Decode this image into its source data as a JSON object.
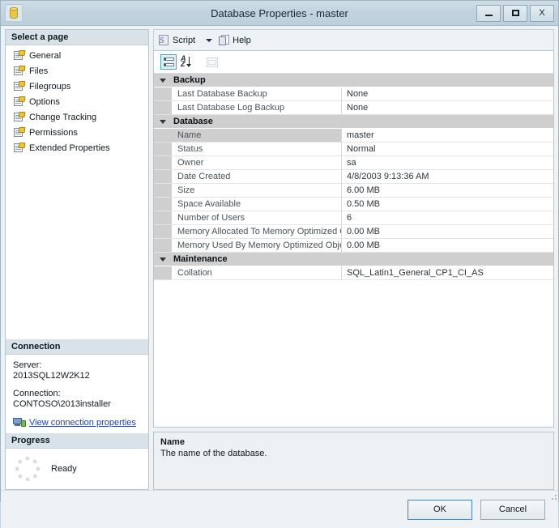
{
  "window": {
    "title": "Database Properties - master",
    "icon": "database-icon",
    "buttons": {
      "minimize": "—",
      "maximize": "□",
      "close": "X"
    }
  },
  "sidebar": {
    "header": "Select a page",
    "items": [
      {
        "label": "General",
        "icon": "page-icon"
      },
      {
        "label": "Files",
        "icon": "page-icon"
      },
      {
        "label": "Filegroups",
        "icon": "page-icon"
      },
      {
        "label": "Options",
        "icon": "page-icon"
      },
      {
        "label": "Change Tracking",
        "icon": "page-icon"
      },
      {
        "label": "Permissions",
        "icon": "page-icon"
      },
      {
        "label": "Extended Properties",
        "icon": "page-icon"
      }
    ]
  },
  "connection": {
    "header": "Connection",
    "server_label": "Server:",
    "server_value": "2013SQL12W2K12",
    "connection_label": "Connection:",
    "connection_value": "CONTOSO\\2013installer",
    "link": "View connection properties",
    "link_icon": "server-connection-icon"
  },
  "progress": {
    "header": "Progress",
    "status": "Ready",
    "icon": "spinner-icon"
  },
  "toolbar": {
    "script_label": "Script",
    "script_icon": "script-icon",
    "dropdown_icon": "chevron-down-icon",
    "help_label": "Help",
    "help_icon": "help-icon"
  },
  "grid_toolbar": {
    "categorized": "categorized-view-icon",
    "alphabetical": "alphabetical-sort-icon",
    "property_pages": "property-pages-icon"
  },
  "grid": {
    "selected_row": "Name",
    "groups": [
      {
        "name": "Backup",
        "rows": [
          {
            "name": "Last Database Backup",
            "value": "None"
          },
          {
            "name": "Last Database Log Backup",
            "value": "None"
          }
        ]
      },
      {
        "name": "Database",
        "rows": [
          {
            "name": "Name",
            "value": "master"
          },
          {
            "name": "Status",
            "value": "Normal"
          },
          {
            "name": "Owner",
            "value": "sa"
          },
          {
            "name": "Date Created",
            "value": "4/8/2003 9:13:36 AM"
          },
          {
            "name": "Size",
            "value": "6.00 MB"
          },
          {
            "name": "Space Available",
            "value": "0.50 MB"
          },
          {
            "name": "Number of Users",
            "value": "6"
          },
          {
            "name": "Memory Allocated To Memory Optimized Obj",
            "value": "0.00 MB"
          },
          {
            "name": "Memory Used By Memory Optimized Objects",
            "value": "0.00 MB"
          }
        ]
      },
      {
        "name": "Maintenance",
        "rows": [
          {
            "name": "Collation",
            "value": "SQL_Latin1_General_CP1_CI_AS"
          }
        ]
      }
    ]
  },
  "description": {
    "title": "Name",
    "text": "The name of the database."
  },
  "footer": {
    "ok": "OK",
    "cancel": "Cancel"
  },
  "colors": {
    "titlebar": "#c2d3de",
    "window_bg": "#eef2f4",
    "category_row": "#cfcfcf",
    "link": "#1a3fd0",
    "focus_border": "#4a90c4"
  }
}
